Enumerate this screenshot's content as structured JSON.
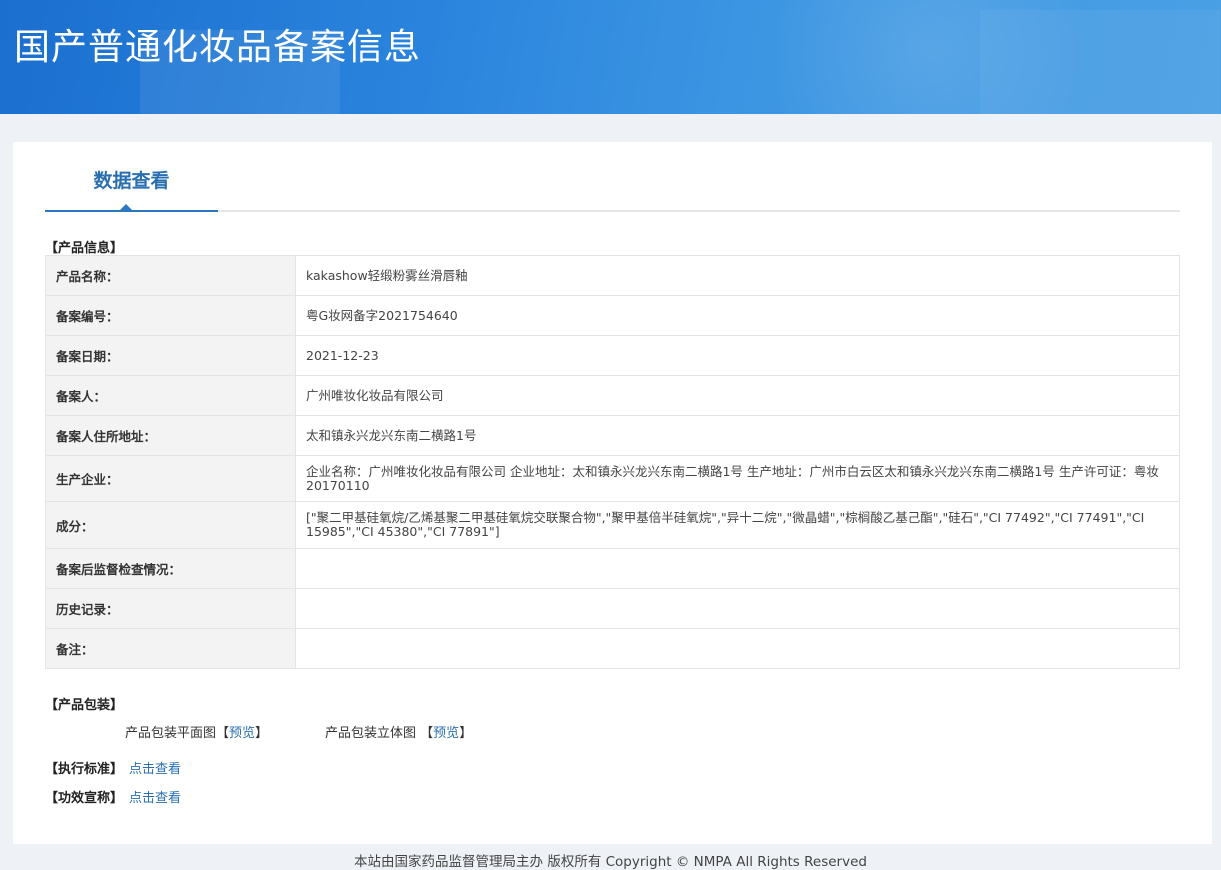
{
  "header": {
    "title": "国产普通化妆品备案信息"
  },
  "tabs": {
    "active": "数据查看"
  },
  "product_info": {
    "section_title": "【产品信息】",
    "rows": [
      {
        "label": "产品名称：",
        "value": "kakashow轻缎粉雾丝滑唇釉"
      },
      {
        "label": "备案编号：",
        "value": "粤G妆网备字2021754640"
      },
      {
        "label": "备案日期：",
        "value": "2021-12-23"
      },
      {
        "label": "备案人：",
        "value": "广州唯妆化妆品有限公司"
      },
      {
        "label": "备案人住所地址：",
        "value": "太和镇永兴龙兴东南二横路1号"
      },
      {
        "label": "生产企业：",
        "value": "企业名称：广州唯妆化妆品有限公司 企业地址：太和镇永兴龙兴东南二横路1号 生产地址：广州市白云区太和镇永兴龙兴东南二横路1号 生产许可证：粤妆20170110"
      },
      {
        "label": "成分：",
        "value": "[\"聚二甲基硅氧烷/乙烯基聚二甲基硅氧烷交联聚合物\",\"聚甲基倍半硅氧烷\",\"异十二烷\",\"微晶蜡\",\"棕榈酸乙基己酯\",\"硅石\",\"CI 77492\",\"CI 77491\",\"CI 15985\",\"CI 45380\",\"CI 77891\"]"
      },
      {
        "label": "备案后监督检查情况：",
        "value": ""
      },
      {
        "label": "历史记录：",
        "value": ""
      },
      {
        "label": "备注：",
        "value": ""
      }
    ]
  },
  "packaging": {
    "section_title": "【产品包装】",
    "flat_label": "产品包装平面图",
    "stereo_label": "产品包装立体图",
    "bracket_open": "【",
    "bracket_close": "】",
    "preview_label": "预览"
  },
  "standard": {
    "label": "【执行标准】",
    "link": "点击查看"
  },
  "efficacy": {
    "label": "【功效宣称】",
    "link": "点击查看"
  },
  "footer": {
    "text": "本站由国家药品监督管理局主办 版权所有 Copyright © NMPA All Rights Reserved"
  },
  "colors": {
    "banner": "#2a84dd",
    "accent": "#2a6fb0",
    "table_border": "#9fc2de"
  }
}
